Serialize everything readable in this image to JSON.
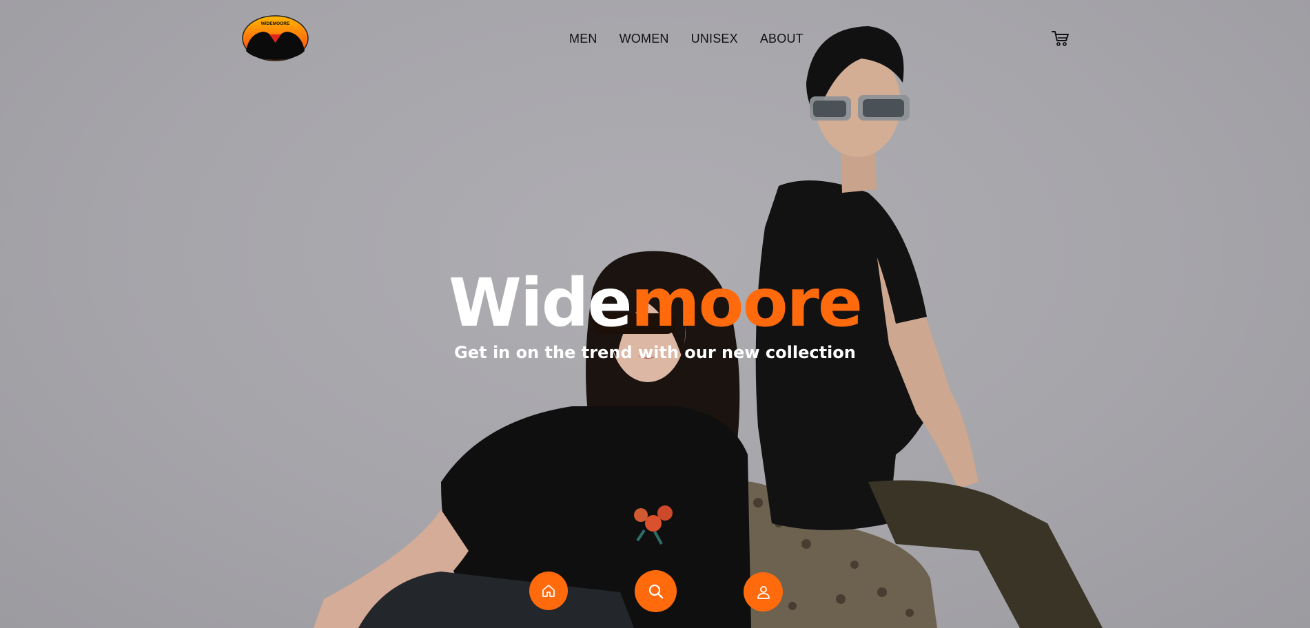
{
  "brand": {
    "logo_text": "WIDEMOORE",
    "title_part1": "Wide",
    "title_part2": "moore",
    "tagline": "Get in on the trend with our new collection"
  },
  "nav": {
    "items": [
      {
        "label": "MEN"
      },
      {
        "label": "WOMEN"
      },
      {
        "label": "UNISEX"
      },
      {
        "label": "ABOUT"
      }
    ]
  },
  "icons": {
    "cart": "cart-icon",
    "home": "home-icon",
    "search": "search-icon",
    "user": "user-icon"
  },
  "colors": {
    "accent": "#ff6a0d",
    "background": "#a6a5aa",
    "text_dark": "#111111",
    "text_light": "#ffffff"
  }
}
